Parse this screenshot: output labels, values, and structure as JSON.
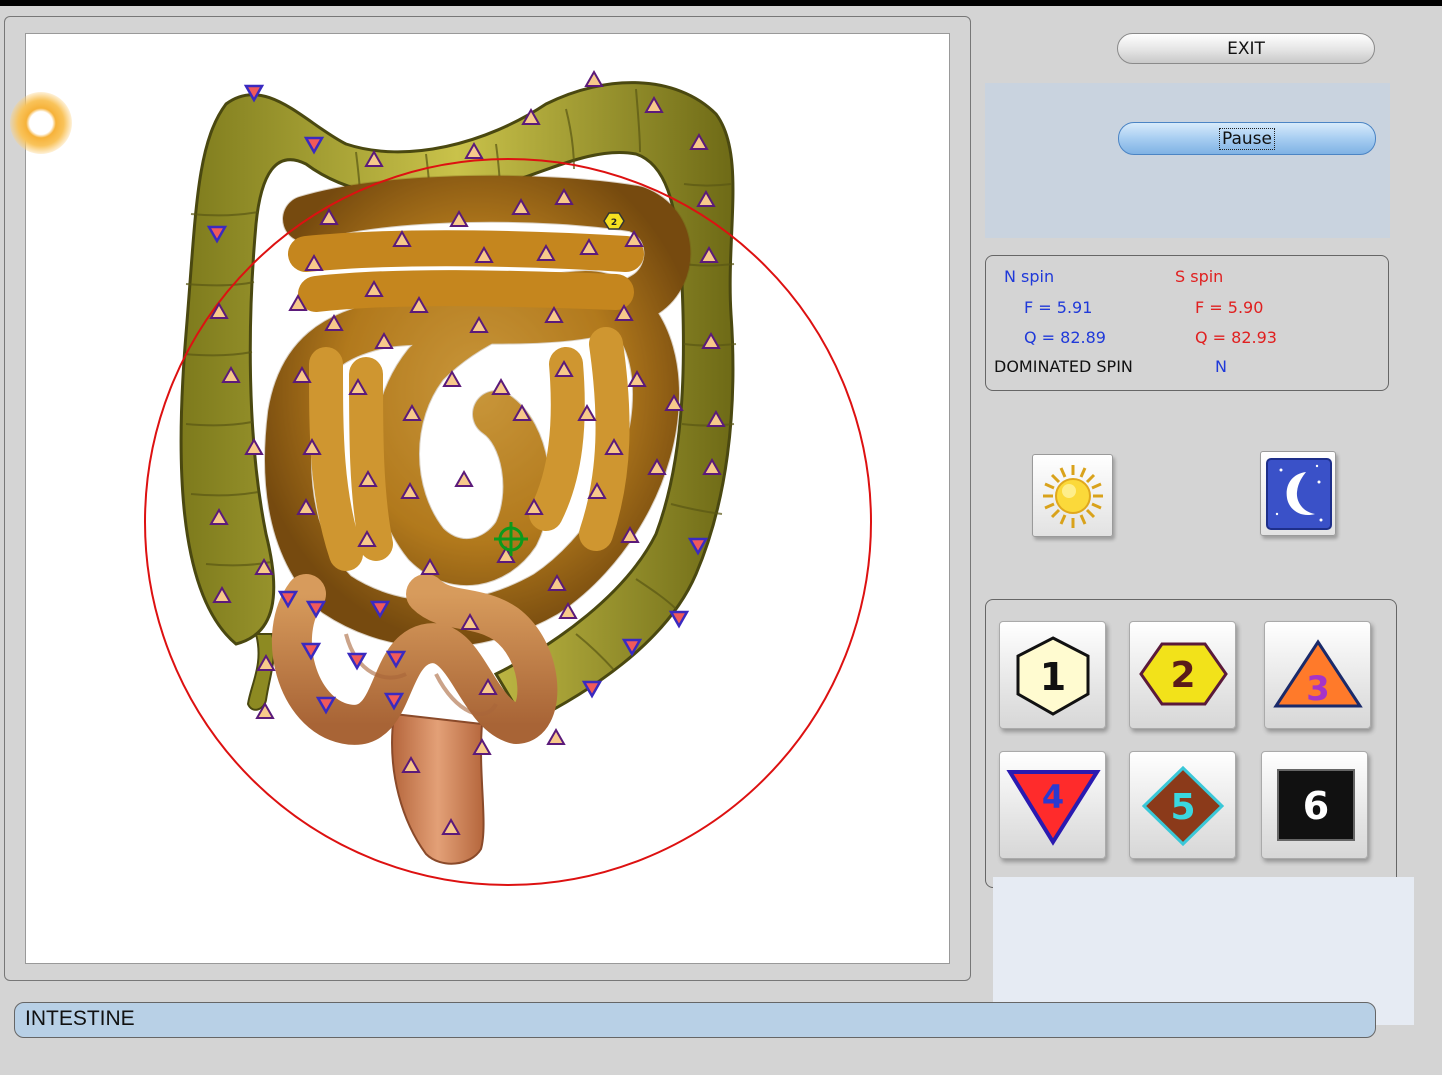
{
  "window": {
    "title": ""
  },
  "controls": {
    "exit_label": "EXIT",
    "pause_label": "Pause"
  },
  "spin": {
    "n_title": "N spin",
    "s_title": "S spin",
    "n_f": "F =  5.91",
    "n_q": "Q = 82.89",
    "s_f": "F =  5.90",
    "s_q": "Q = 82.93",
    "dominated_label": "DOMINATED SPIN",
    "dominated_value": "N",
    "colors": {
      "n": "#1f39d9",
      "s": "#e02020"
    }
  },
  "mode_buttons": [
    {
      "name": "day-mode",
      "icon": "sun-icon"
    },
    {
      "name": "night-mode",
      "icon": "moon-icon"
    }
  ],
  "level_buttons": [
    {
      "label": "1",
      "shape": "hexagon",
      "fill": "#fffbd0"
    },
    {
      "label": "2",
      "shape": "hexagon",
      "fill": "#f2e21a"
    },
    {
      "label": "3",
      "shape": "triangle",
      "fill": "#ff7a2a"
    },
    {
      "label": "4",
      "shape": "inverted-triangle",
      "fill": "#ff2b2b"
    },
    {
      "label": "5",
      "shape": "diamond",
      "fill": "#8b3a1a"
    },
    {
      "label": "6",
      "shape": "square",
      "fill": "#111111"
    }
  ],
  "markers": {
    "cursor_label": "2"
  },
  "status": {
    "organ": "INTESTINE"
  }
}
